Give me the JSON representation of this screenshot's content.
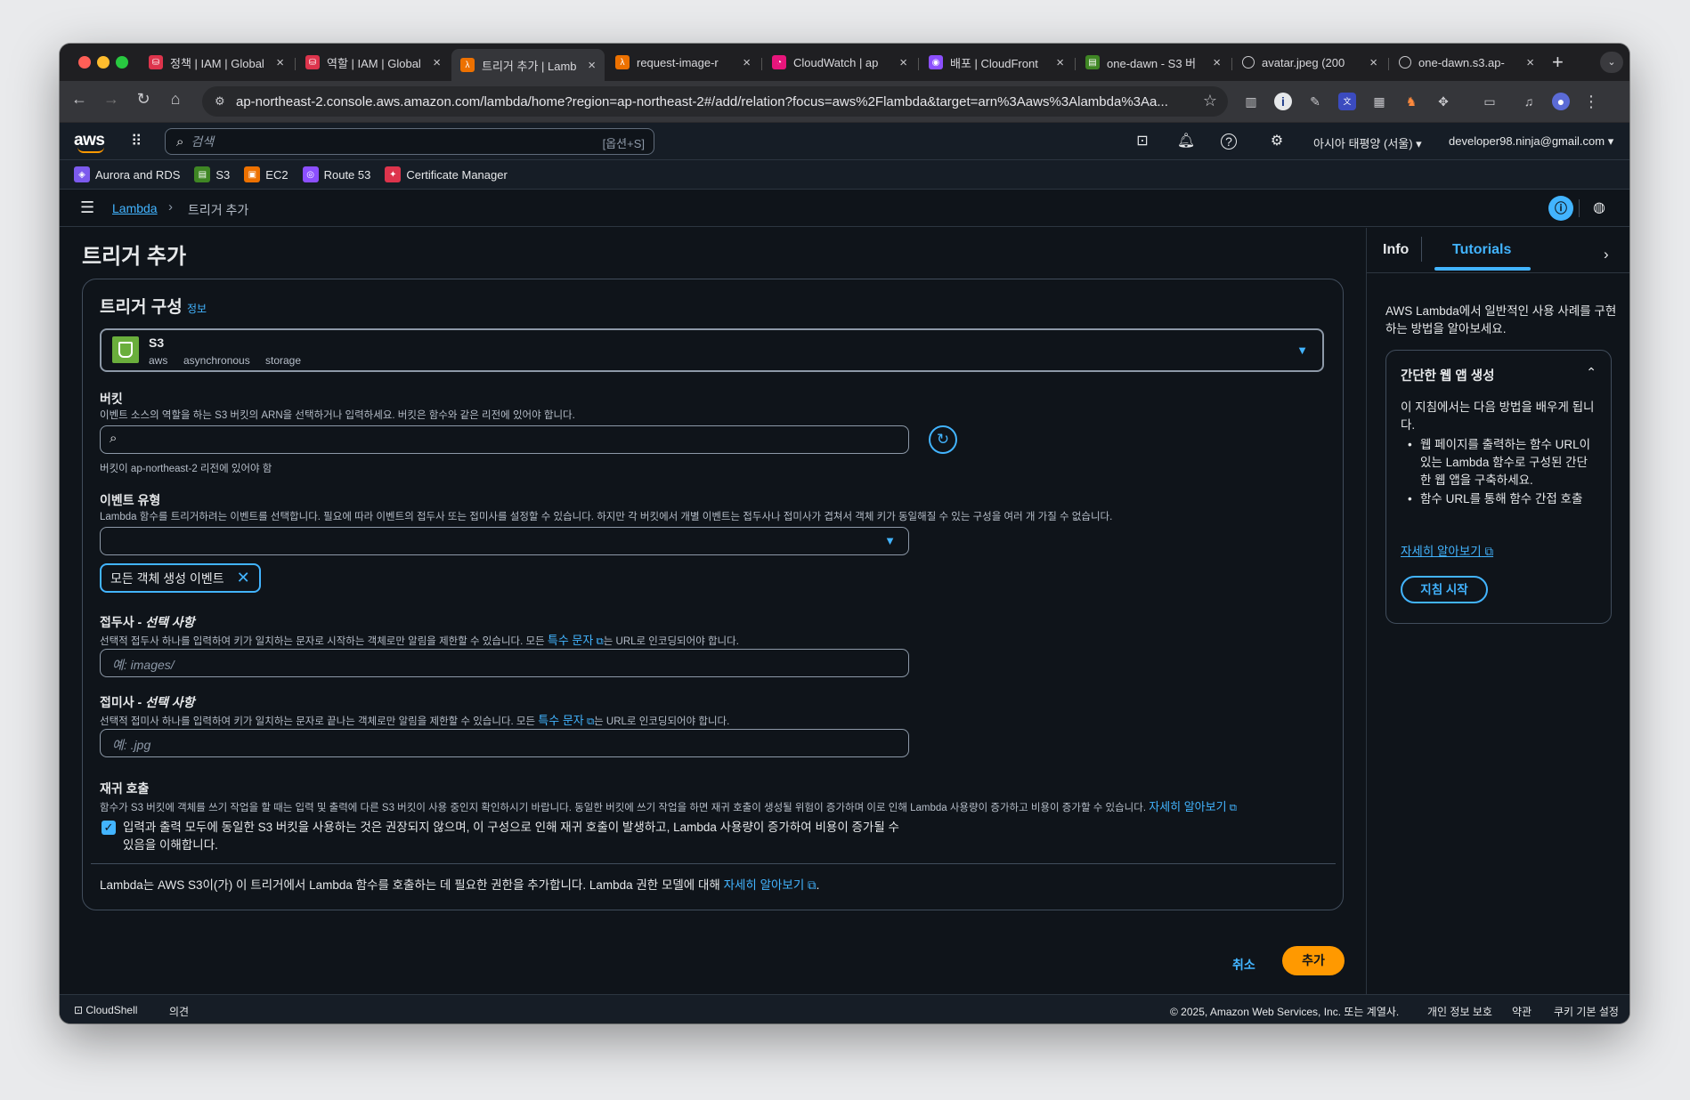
{
  "browser": {
    "tabs": [
      {
        "label": "정책 | IAM | Global",
        "icon": "iam-icon",
        "color": "#dd344c"
      },
      {
        "label": "역할 | IAM | Global",
        "icon": "iam-icon",
        "color": "#dd344c"
      },
      {
        "label": "트리거 추가 | Lamb",
        "icon": "lambda-icon",
        "color": "#ed7100"
      },
      {
        "label": "request-image-r",
        "icon": "lambda-icon",
        "color": "#ed7100"
      },
      {
        "label": "CloudWatch | ap",
        "icon": "cloudwatch-icon",
        "color": "#e7157b"
      },
      {
        "label": "배포 | CloudFront",
        "icon": "cloudfront-icon",
        "color": "#8c4fff"
      },
      {
        "label": "one-dawn - S3 버",
        "icon": "s3-icon",
        "color": "#3f8624"
      },
      {
        "label": "avatar.jpeg (200",
        "icon": "globe-icon",
        "color": ""
      },
      {
        "label": "one-dawn.s3.ap-",
        "icon": "globe-icon",
        "color": ""
      }
    ],
    "url": "ap-northeast-2.console.aws.amazon.com/lambda/home?region=ap-northeast-2#/add/relation?focus=aws%2Flambda&target=arn%3Aaws%3Alambda%3Aa..."
  },
  "aws": {
    "logo": "aws",
    "search_placeholder": "검색",
    "search_shortcut": "[옵션+S]",
    "region": "아시아 태평양 (서울)",
    "account": "developer98.ninja@gmail.com",
    "favorites": [
      {
        "label": "Aurora and RDS",
        "color": "#7c5aed"
      },
      {
        "label": "S3",
        "color": "#3f8624"
      },
      {
        "label": "EC2",
        "color": "#ed7100"
      },
      {
        "label": "Route 53",
        "color": "#8c4fff"
      },
      {
        "label": "Certificate Manager",
        "color": "#dd344c"
      }
    ]
  },
  "breadcrumb": {
    "root": "Lambda",
    "current": "트리거 추가"
  },
  "page": {
    "title": "트리거 추가",
    "section_title": "트리거 구성",
    "info_link": "정보",
    "source": {
      "name": "S3",
      "tags": [
        "aws",
        "asynchronous",
        "storage"
      ]
    },
    "bucket": {
      "label": "버킷",
      "desc": "이벤트 소스의 역할을 하는 S3 버킷의 ARN을 선택하거나 입력하세요. 버킷은 함수와 같은 리전에 있어야 합니다.",
      "hint": "버킷이 ap-northeast-2 리전에 있어야 함"
    },
    "event_type": {
      "label": "이벤트 유형",
      "desc": "Lambda 함수를 트리거하려는 이벤트를 선택합니다. 필요에 따라 이벤트의 접두사 또는 접미사를 설정할 수 있습니다. 하지만 각 버킷에서 개별 이벤트는 접두사나 접미사가 겹쳐서 객체 키가 동일해질 수 있는 구성을 여러 개 가질 수 없습니다.",
      "token": "모든 객체 생성 이벤트"
    },
    "prefix": {
      "label": "접두사 - ",
      "optional": "선택 사항",
      "desc_a": "선택적 접두사 하나를 입력하여 키가 일치하는 문자로 시작하는 객체로만 알림을 제한할 수 있습니다. 모든 ",
      "link": "특수 문자",
      "desc_b": "는 URL로 인코딩되어야 합니다.",
      "placeholder": "예: images/"
    },
    "suffix": {
      "label": "접미사 - ",
      "optional": "선택 사항",
      "desc_a": "선택적 접미사 하나를 입력하여 키가 일치하는 문자로 끝나는 객체로만 알림을 제한할 수 있습니다. 모든 ",
      "link": "특수 문자",
      "desc_b": "는 URL로 인코딩되어야 합니다.",
      "placeholder": "예: .jpg"
    },
    "recursive": {
      "label": "재귀 호출",
      "desc": "함수가 S3 버킷에 객체를 쓰기 작업을 할 때는 입력 및 출력에 다른 S3 버킷이 사용 중인지 확인하시기 바랍니다. 동일한 버킷에 쓰기 작업을 하면 재귀 호출이 생성될 위험이 증가하며 이로 인해 Lambda 사용량이 증가하고 비용이 증가할 수 있습니다. ",
      "link": "자세히 알아보기",
      "checkbox_line1": "입력과 출력 모두에 동일한 S3 버킷을 사용하는 것은 권장되지 않으며, 이 구성으로 인해 재귀 호출이 발생하고, Lambda 사용량이 증가하여 비용이 증가될 수",
      "checkbox_line2": "있음을 이해합니다.",
      "checked": true
    },
    "permission": {
      "text": "Lambda는 AWS S3이(가) 이 트리거에서 Lambda 함수를 호출하는 데 필요한 권한을 추가합니다. Lambda 권한 모델에 대해 ",
      "link": "자세히 알아보기",
      "end": "."
    },
    "cancel": "취소",
    "add": "추가"
  },
  "side_panel": {
    "tabs": [
      "Info",
      "Tutorials"
    ],
    "active_tab": "Tutorials",
    "intro": "AWS Lambda에서 일반적인 사용 사례를 구현하는 방법을 알아보세요.",
    "card": {
      "title": "간단한 웹 앱 생성",
      "lead": "이 지침에서는 다음 방법을 배우게 됩니다.",
      "bullets": [
        "웹 페이지를 출력하는 함수 URL이 있는 Lambda 함수로 구성된 간단한 웹 앱을 구축하세요.",
        "함수 URL를 통해 함수 간접 호출"
      ],
      "link": "자세히 알아보기",
      "button": "지침 시작"
    }
  },
  "footer": {
    "cloudshell": "CloudShell",
    "feedback": "의견",
    "copyright": "© 2025, Amazon Web Services, Inc. 또는 계열사.",
    "links": [
      "개인 정보 보호",
      "약관",
      "쿠키 기본 설정"
    ]
  },
  "colors": {
    "accent": "#42b4ff",
    "primary_button": "#ff9900",
    "background": "#0f141a"
  }
}
